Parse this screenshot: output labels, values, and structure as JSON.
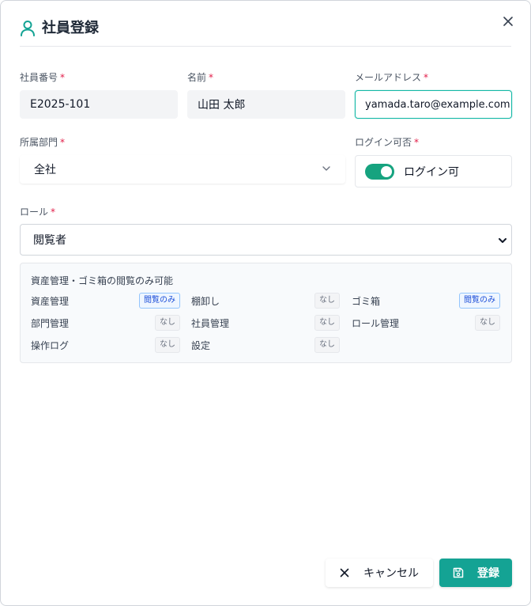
{
  "dialog": {
    "title": "社員登録",
    "close_icon": "close-icon"
  },
  "fields": {
    "employee_no": {
      "label": "社員番号",
      "required": "*",
      "value": "E2025-101"
    },
    "name": {
      "label": "名前",
      "required": "*",
      "value": "山田 太郎"
    },
    "email": {
      "label": "メールアドレス",
      "required": "*",
      "value": "yamada.taro@example.com"
    },
    "department": {
      "label": "所属部門",
      "required": "*",
      "value": "全社"
    },
    "login": {
      "label": "ログイン可否",
      "required": "*",
      "toggle_label": "ログイン可",
      "enabled": true
    },
    "role": {
      "label": "ロール",
      "required": "*",
      "value": "閲覧者"
    }
  },
  "permissions": {
    "summary": "資産管理・ゴミ箱の閲覧のみ可能",
    "items": [
      {
        "name": "資産管理",
        "level": "閲覧のみ"
      },
      {
        "name": "棚卸し",
        "level": "なし"
      },
      {
        "name": "ゴミ箱",
        "level": "閲覧のみ"
      },
      {
        "name": "部門管理",
        "level": "なし"
      },
      {
        "name": "社員管理",
        "level": "なし"
      },
      {
        "name": "ロール管理",
        "level": "なし"
      },
      {
        "name": "操作ログ",
        "level": "なし"
      },
      {
        "name": "設定",
        "level": "なし"
      }
    ]
  },
  "footer": {
    "cancel_label": "キャンセル",
    "submit_label": "登録"
  },
  "colors": {
    "accent": "#14a394",
    "required": "#e11d48",
    "badge_view": "#1d4ed8"
  }
}
